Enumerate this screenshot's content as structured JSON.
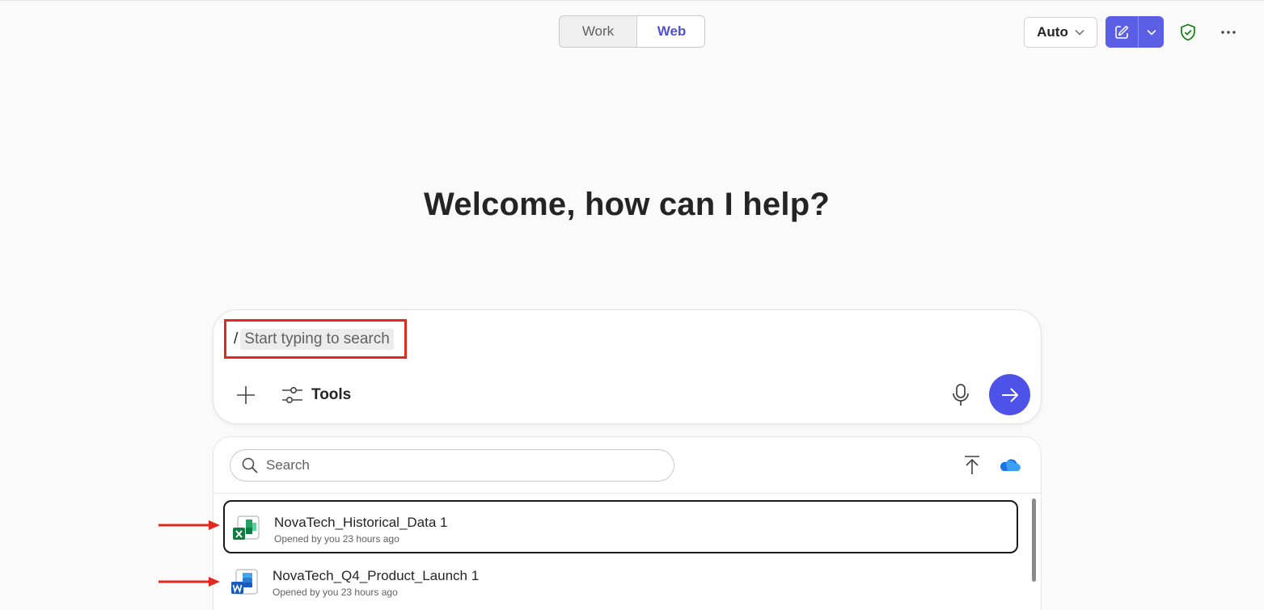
{
  "header": {
    "tabs": [
      {
        "label": "Work",
        "active": false
      },
      {
        "label": "Web",
        "active": true
      }
    ],
    "model_select": {
      "value": "Auto"
    },
    "accent_color": "#5b5fe6"
  },
  "main": {
    "title": "Welcome, how can I help?"
  },
  "composer": {
    "prefix": "/",
    "search_chip": "Start typing to search",
    "tools_label": "Tools"
  },
  "picker": {
    "search_placeholder": "Search",
    "files": [
      {
        "name": "NovaTech_Historical_Data 1",
        "meta": "Opened by you 23 hours ago",
        "type": "excel",
        "selected": true
      },
      {
        "name": "NovaTech_Q4_Product_Launch 1",
        "meta": "Opened by you 23 hours ago",
        "type": "word",
        "selected": false
      }
    ]
  },
  "annotations": {
    "highlight_color": "#e2291f"
  }
}
